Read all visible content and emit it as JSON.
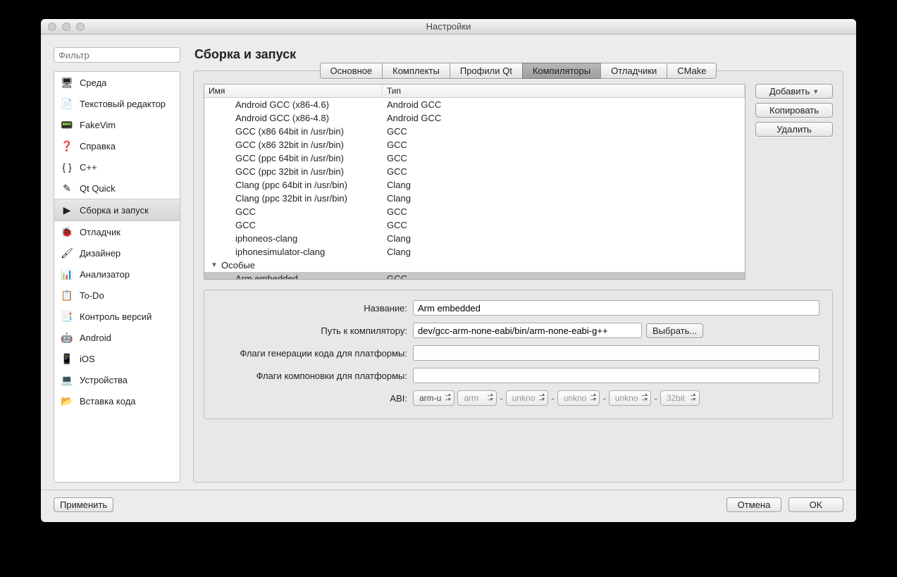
{
  "window": {
    "title": "Настройки"
  },
  "filter": {
    "placeholder": "Фильтр"
  },
  "sidebar": {
    "items": [
      {
        "label": "Среда",
        "icon": "🖥"
      },
      {
        "label": "Текстовый редактор",
        "icon": "📄"
      },
      {
        "label": "FakeVim",
        "icon": "📟"
      },
      {
        "label": "Справка",
        "icon": "❓"
      },
      {
        "label": "C++",
        "icon": "{ }"
      },
      {
        "label": "Qt Quick",
        "icon": "✎"
      },
      {
        "label": "Сборка и запуск",
        "icon": "▶"
      },
      {
        "label": "Отладчик",
        "icon": "🐞"
      },
      {
        "label": "Дизайнер",
        "icon": "🖌"
      },
      {
        "label": "Анализатор",
        "icon": "📊"
      },
      {
        "label": "To-Do",
        "icon": "📋"
      },
      {
        "label": "Контроль версий",
        "icon": "📑"
      },
      {
        "label": "Android",
        "icon": "🤖"
      },
      {
        "label": "iOS",
        "icon": "📱"
      },
      {
        "label": "Устройства",
        "icon": "💻"
      },
      {
        "label": "Вставка кода",
        "icon": "📂"
      }
    ],
    "selected_index": 6
  },
  "page": {
    "heading": "Сборка и запуск"
  },
  "tabs": {
    "items": [
      {
        "label": "Основное"
      },
      {
        "label": "Комплекты"
      },
      {
        "label": "Профили Qt"
      },
      {
        "label": "Компиляторы"
      },
      {
        "label": "Отладчики"
      },
      {
        "label": "CMake"
      }
    ],
    "active_index": 3
  },
  "table": {
    "headers": {
      "name": "Имя",
      "type": "Тип"
    },
    "rows": [
      {
        "name": "Android GCC (x86-4.6)",
        "type": "Android GCC"
      },
      {
        "name": "Android GCC (x86-4.8)",
        "type": "Android GCC"
      },
      {
        "name": "GCC (x86 64bit in /usr/bin)",
        "type": "GCC"
      },
      {
        "name": "GCC (x86 32bit in /usr/bin)",
        "type": "GCC"
      },
      {
        "name": "GCC (ppc 64bit in /usr/bin)",
        "type": "GCC"
      },
      {
        "name": "GCC (ppc 32bit in /usr/bin)",
        "type": "GCC"
      },
      {
        "name": "Clang (ppc 64bit in /usr/bin)",
        "type": "Clang"
      },
      {
        "name": "Clang (ppc 32bit in /usr/bin)",
        "type": "Clang"
      },
      {
        "name": "GCC",
        "type": "GCC"
      },
      {
        "name": "GCC",
        "type": "GCC"
      },
      {
        "name": "iphoneos-clang",
        "type": "Clang"
      },
      {
        "name": "iphonesimulator-clang",
        "type": "Clang"
      }
    ],
    "group_label": "Особые",
    "group_rows": [
      {
        "name": "Arm embedded",
        "type": "GCC"
      }
    ],
    "selected_group_row": 0
  },
  "buttons": {
    "add": "Добавить",
    "copy": "Копировать",
    "delete": "Удалить",
    "browse": "Выбрать..."
  },
  "form": {
    "name_label": "Название:",
    "name_value": "Arm embedded",
    "path_label": "Путь к компилятору:",
    "path_value": "dev/gcc-arm-none-eabi/bin/arm-none-eabi-g++",
    "codegen_label": "Флаги генерации кода для платформы:",
    "codegen_value": "",
    "link_label": "Флаги компоновки для платформы:",
    "link_value": "",
    "abi_label": "ABI:",
    "abi": {
      "preset": "arm-u",
      "arch": "arm",
      "os": "unkno",
      "flavor": "unkno",
      "format": "unkno",
      "width": "32bit"
    }
  },
  "footer": {
    "apply": "Применить",
    "cancel": "Отмена",
    "ok": "OK"
  }
}
